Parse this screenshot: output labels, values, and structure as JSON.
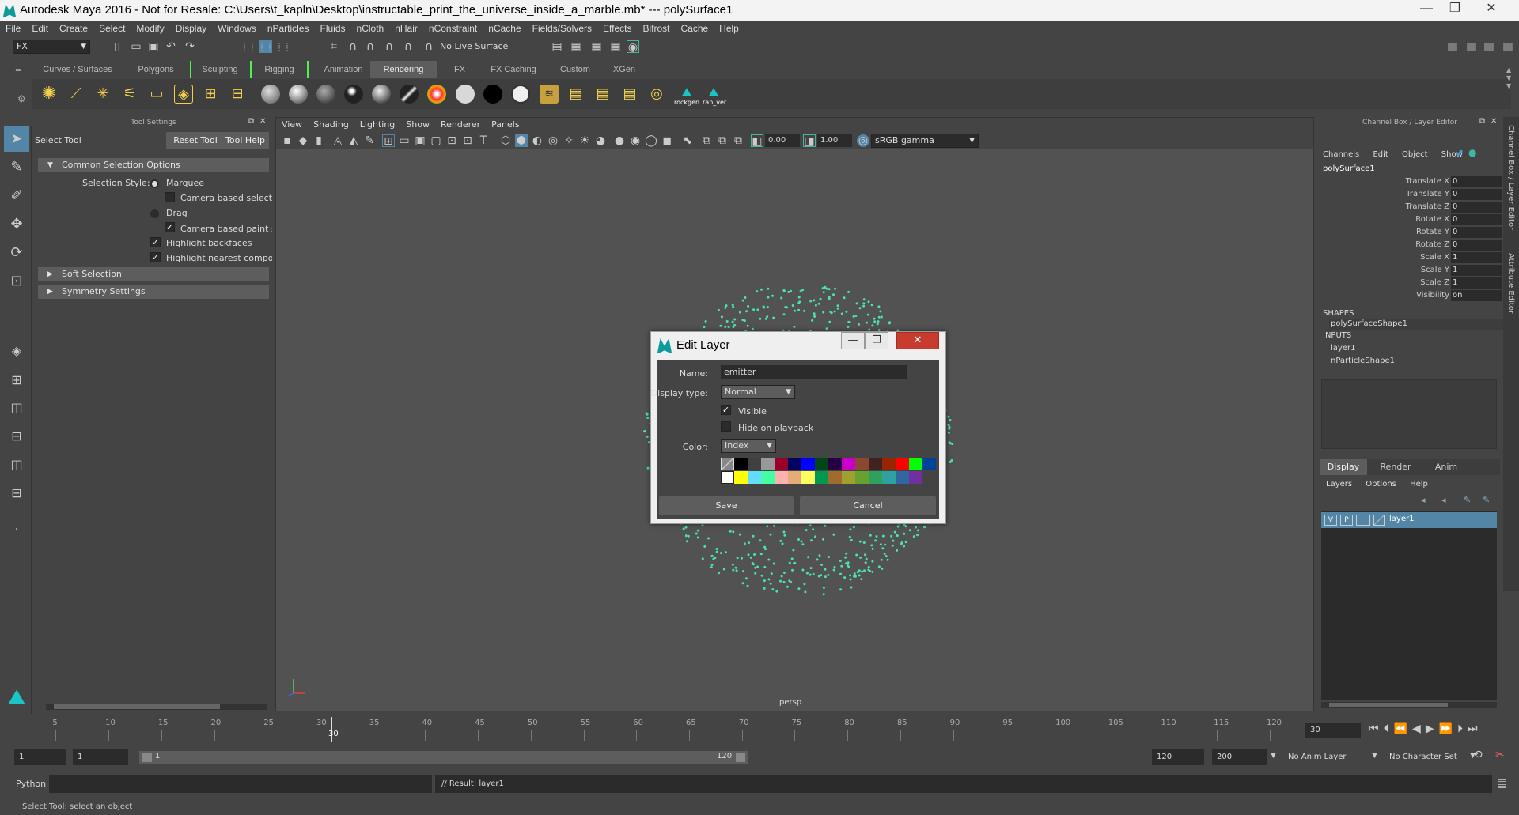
{
  "window": {
    "title": "Autodesk Maya 2016 - Not for Resale: C:\\Users\\t_kapln\\Desktop\\instructable_print_the_universe_inside_a_marble.mb*   ---   polySurface1",
    "controls": [
      "—",
      "❐",
      "✕"
    ]
  },
  "menubar": [
    "File",
    "Edit",
    "Create",
    "Select",
    "Modify",
    "Display",
    "Windows",
    "nParticles",
    "Fluids",
    "nCloth",
    "nHair",
    "nConstraint",
    "nCache",
    "Fields/Solvers",
    "Effects",
    "Bifrost",
    "Cache",
    "Help"
  ],
  "status_line": {
    "menu_set": "FX",
    "live_surface": "No Live Surface"
  },
  "shelf": {
    "tabs": [
      "Curves / Surfaces",
      "Polygons",
      "Sculpting",
      "Rigging",
      "Animation",
      "Rendering",
      "FX",
      "FX Caching",
      "Custom",
      "XGen"
    ],
    "active_tab": "Rendering",
    "icon_labels": [
      "rockgen",
      "ran_ver"
    ]
  },
  "tool_settings": {
    "panel_title": "Tool Settings",
    "tool_name": "Select Tool",
    "reset_button": "Reset Tool",
    "help_button": "Tool Help",
    "sections": {
      "common": "Common Selection Options",
      "soft": "Soft Selection",
      "symmetry": "Symmetry Settings"
    },
    "selection_style_label": "Selection Style:",
    "marquee": "Marquee",
    "camera_based_selection": "Camera based selecti",
    "drag": "Drag",
    "camera_based_paint": "Camera based paint s",
    "highlight_backfaces": "Highlight backfaces",
    "highlight_nearest": "Highlight nearest compo"
  },
  "viewport": {
    "menus": [
      "View",
      "Shading",
      "Lighting",
      "Show",
      "Renderer",
      "Panels"
    ],
    "exposure": "0.00",
    "gamma": "1.00",
    "color_space": "sRGB gamma",
    "camera_label": "persp"
  },
  "channel_box": {
    "panel_title": "Channel Box / Layer Editor",
    "menus": [
      "Channels",
      "Edit",
      "Object",
      "Show"
    ],
    "object_name": "polySurface1",
    "attributes": [
      {
        "name": "Translate X",
        "value": "0"
      },
      {
        "name": "Translate Y",
        "value": "0"
      },
      {
        "name": "Translate Z",
        "value": "0"
      },
      {
        "name": "Rotate X",
        "value": "0"
      },
      {
        "name": "Rotate Y",
        "value": "0"
      },
      {
        "name": "Rotate Z",
        "value": "0"
      },
      {
        "name": "Scale X",
        "value": "1"
      },
      {
        "name": "Scale Y",
        "value": "1"
      },
      {
        "name": "Scale Z",
        "value": "1"
      },
      {
        "name": "Visibility",
        "value": "on"
      }
    ],
    "shapes_header": "SHAPES",
    "shape_name": "polySurfaceShape1",
    "inputs_header": "INPUTS",
    "inputs": [
      "layer1",
      "nParticleShape1"
    ]
  },
  "layer_editor": {
    "tabs": [
      "Display",
      "Render",
      "Anim"
    ],
    "active_tab": "Display",
    "menus": [
      "Layers",
      "Options",
      "Help"
    ],
    "layer": {
      "v": "V",
      "p": "P",
      "name": "layer1"
    }
  },
  "side_tabs": [
    "Channel Box / Layer Editor",
    "Attribute Editor"
  ],
  "time_slider": {
    "ticks": [
      "5",
      "10",
      "15",
      "20",
      "25",
      "30",
      "35",
      "40",
      "45",
      "50",
      "55",
      "60",
      "65",
      "70",
      "75",
      "80",
      "85",
      "90",
      "95",
      "100",
      "105",
      "110",
      "115",
      "120"
    ],
    "current_frame": "30",
    "current_frame_field": "30"
  },
  "range_slider": {
    "start": "1",
    "playback_start": "1",
    "range_start_label": "1",
    "range_end_label": "120",
    "playback_end": "120",
    "end": "200",
    "anim_layer": "No Anim Layer",
    "character_set": "No Character Set"
  },
  "command_line": {
    "language": "Python",
    "result": "// Result: layer1"
  },
  "help_line": "Select Tool: select an object",
  "edit_layer_dialog": {
    "title": "Edit Layer",
    "name_label": "Name:",
    "name_value": "emitter",
    "display_type_label": "Display type:",
    "display_type_value": "Normal",
    "visible_label": "Visible",
    "visible_checked": true,
    "hide_on_playback_label": "Hide on playback",
    "hide_on_playback_checked": false,
    "color_label": "Color:",
    "color_mode": "Index",
    "palette_row1": [
      "#000000",
      "#404040",
      "#999999",
      "#9b0028",
      "#000460",
      "#0000ff",
      "#004619",
      "#250043",
      "#c800c8",
      "#8a4733",
      "#3f231f",
      "#992600",
      "#ff0000",
      "#00ff00",
      "#004199"
    ],
    "palette_row2": [
      "#ffffff",
      "#ffff00",
      "#64dcff",
      "#43ffa3",
      "#ffb0b0",
      "#e4ac79",
      "#ffff63",
      "#009954",
      "#a16a30",
      "#9ea130",
      "#68a130",
      "#30a15d",
      "#30a1a1",
      "#3067a1",
      "#6f30a1"
    ],
    "save_button": "Save",
    "cancel_button": "Cancel"
  }
}
